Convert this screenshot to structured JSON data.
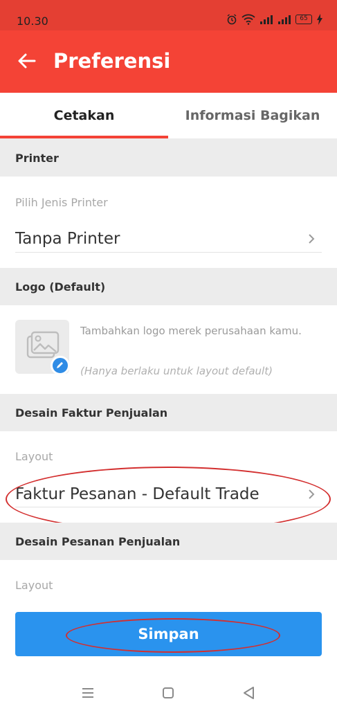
{
  "status_bar": {
    "time": "10.30",
    "battery": "65"
  },
  "app_bar": {
    "title": "Preferensi",
    "back_icon": "arrow-left-icon"
  },
  "tabs": [
    {
      "label": "Cetakan",
      "active": true
    },
    {
      "label": "Informasi Bagikan",
      "active": false
    }
  ],
  "printer_section": {
    "header": "Printer",
    "label": "Pilih Jenis Printer",
    "value": "Tanpa Printer"
  },
  "logo_section": {
    "header": "Logo (Default)",
    "description": "Tambahkan logo merek perusahaan kamu.",
    "note": "(Hanya berlaku untuk layout default)"
  },
  "sales_invoice_section": {
    "header": "Desain Faktur Penjualan",
    "label": "Layout",
    "value": "Faktur Pesanan - Default Trade"
  },
  "sales_order_section": {
    "header": "Desain Pesanan Penjualan",
    "label": "Layout"
  },
  "actions": {
    "save_label": "Simpan"
  },
  "colors": {
    "primary": "#f44336",
    "status_bar": "#e43f33",
    "button": "#2a93ee",
    "annotation": "#d32f2f"
  }
}
